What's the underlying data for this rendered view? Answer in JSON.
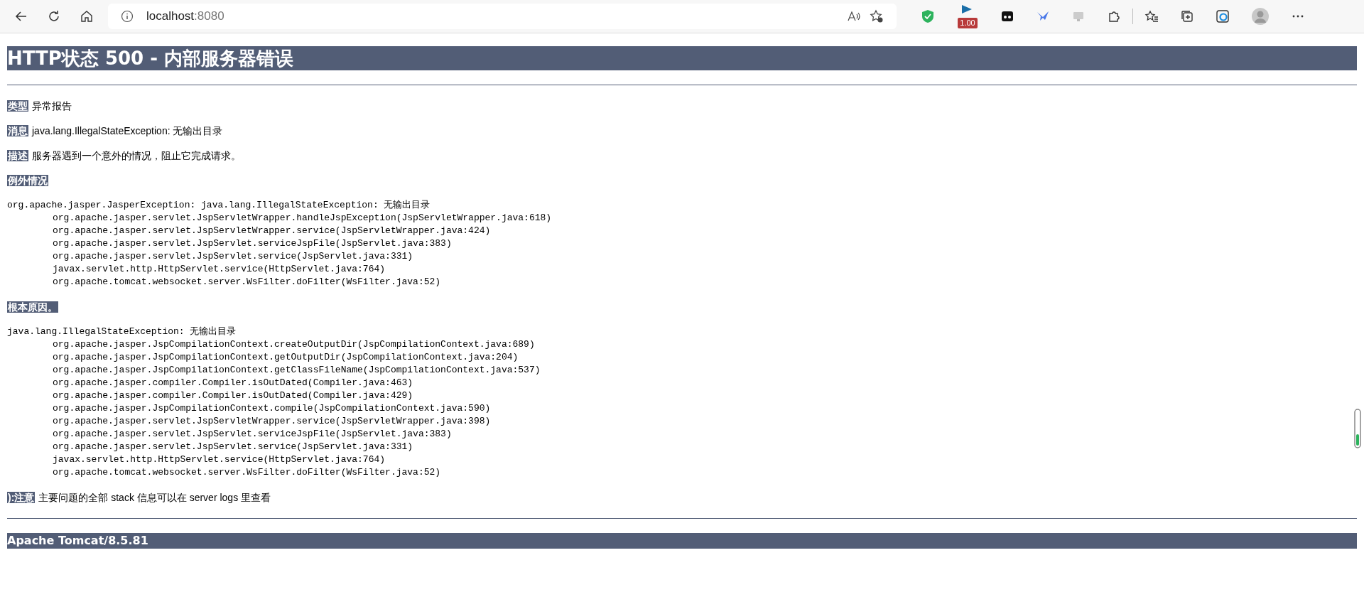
{
  "browser": {
    "address_host": "localhost",
    "address_port": ":8080",
    "extension_badge": "1.00"
  },
  "page": {
    "title": "HTTP状态 500 - 内部服务器错误",
    "fields": [
      {
        "label": "类型",
        "value": "异常报告"
      },
      {
        "label": "消息",
        "value": "java.lang.IllegalStateException: 无输出目录"
      },
      {
        "label": "描述",
        "value": "服务器遇到一个意外的情况，阻止它完成请求。"
      }
    ],
    "sections": [
      {
        "label": "例外情况",
        "header": "org.apache.jasper.JasperException: java.lang.IllegalStateException: 无输出目录",
        "frames": [
          "org.apache.jasper.servlet.JspServletWrapper.handleJspException(JspServletWrapper.java:618)",
          "org.apache.jasper.servlet.JspServletWrapper.service(JspServletWrapper.java:424)",
          "org.apache.jasper.servlet.JspServlet.serviceJspFile(JspServlet.java:383)",
          "org.apache.jasper.servlet.JspServlet.service(JspServlet.java:331)",
          "javax.servlet.http.HttpServlet.service(HttpServlet.java:764)",
          "org.apache.tomcat.websocket.server.WsFilter.doFilter(WsFilter.java:52)"
        ]
      },
      {
        "label": "根本原因。",
        "header": "java.lang.IllegalStateException: 无输出目录",
        "frames": [
          "org.apache.jasper.JspCompilationContext.createOutputDir(JspCompilationContext.java:689)",
          "org.apache.jasper.JspCompilationContext.getOutputDir(JspCompilationContext.java:204)",
          "org.apache.jasper.JspCompilationContext.getClassFileName(JspCompilationContext.java:537)",
          "org.apache.jasper.compiler.Compiler.isOutDated(Compiler.java:463)",
          "org.apache.jasper.compiler.Compiler.isOutDated(Compiler.java:429)",
          "org.apache.jasper.JspCompilationContext.compile(JspCompilationContext.java:590)",
          "org.apache.jasper.servlet.JspServletWrapper.service(JspServletWrapper.java:398)",
          "org.apache.jasper.servlet.JspServlet.serviceJspFile(JspServlet.java:383)",
          "org.apache.jasper.servlet.JspServlet.service(JspServlet.java:331)",
          "javax.servlet.http.HttpServlet.service(HttpServlet.java:764)",
          "org.apache.tomcat.websocket.server.WsFilter.doFilter(WsFilter.java:52)"
        ]
      }
    ],
    "note": {
      "label": "):注意",
      "value": "主要问题的全部 stack 信息可以在 server logs 里查看"
    },
    "footer": "Apache Tomcat/8.5.81"
  }
}
